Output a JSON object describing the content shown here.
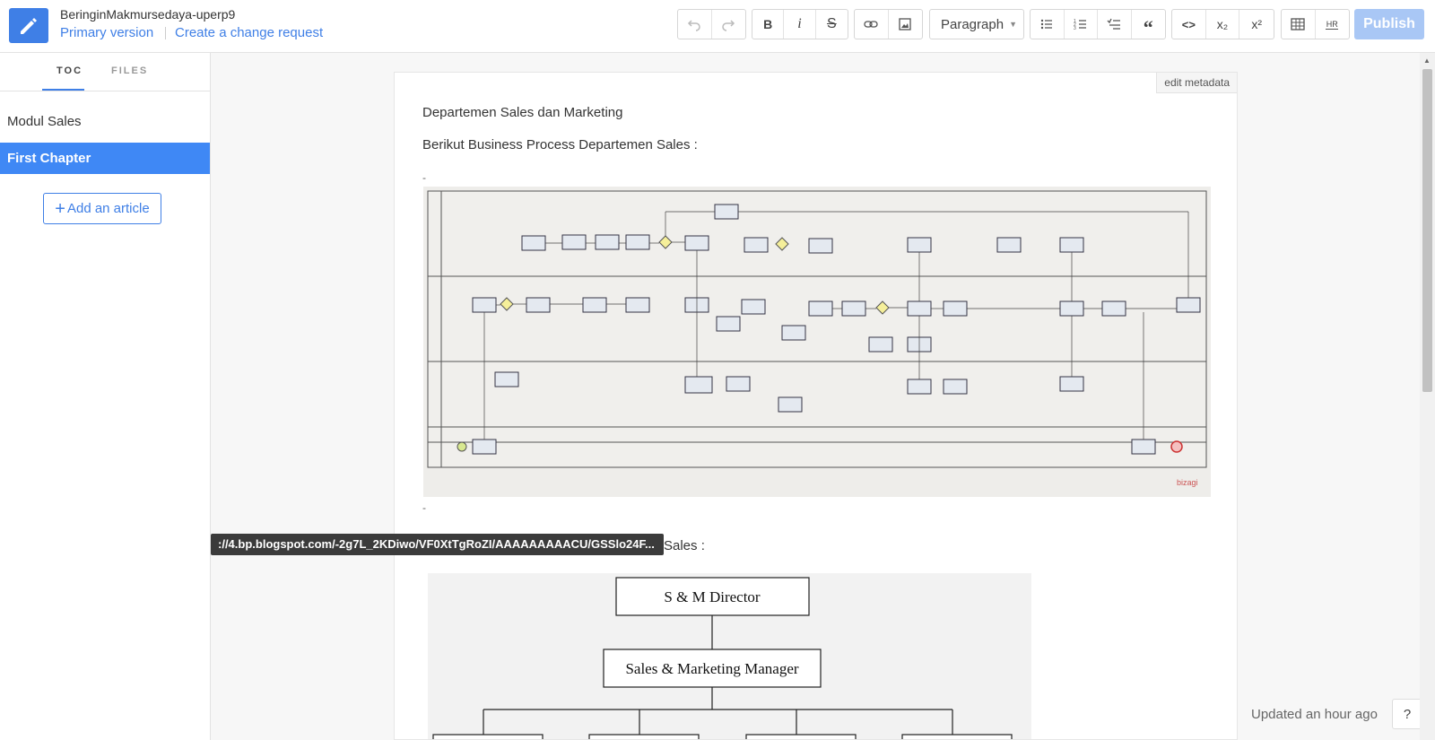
{
  "header": {
    "book_title": "BeringinMakmursedaya-uperp9",
    "primary_version": "Primary version",
    "change_request": "Create a change request",
    "paragraph_select": "Paragraph",
    "publish": "Publish",
    "toolbar_labels": {
      "bold": "B",
      "italic": "i",
      "strike": "S",
      "quote": "“",
      "code": "<>",
      "sub": "x₂",
      "sup": "x²",
      "hr": "HR"
    }
  },
  "sidebar": {
    "tabs": [
      "TOC",
      "FILES"
    ],
    "items": [
      {
        "label": "Modul Sales",
        "active": false
      },
      {
        "label": "First Chapter",
        "active": true
      }
    ],
    "add_article": "Add an article"
  },
  "content": {
    "edit_metadata": "edit metadata",
    "paragraph1": "Departemen Sales dan Marketing",
    "paragraph2": "Berikut Business Process Departemen Sales :",
    "dash1": "-",
    "dash2": "-",
    "paragraph3": "Sales :",
    "bpmn_watermark": "bizagi",
    "org_chart": {
      "top": "S & M Director",
      "second": "Sales & Marketing Manager"
    }
  },
  "tooltip_url": "://4.bp.blogspot.com/-2g7L_2KDiwo/VF0XtTgRoZI/AAAAAAAAACU/GSSlo24F...",
  "footer": {
    "updated": "Updated an hour ago",
    "help": "?"
  },
  "colors": {
    "accent": "#3f7fe6",
    "active_item": "#3f88f5",
    "publish_disabled": "#a9c7f5"
  }
}
